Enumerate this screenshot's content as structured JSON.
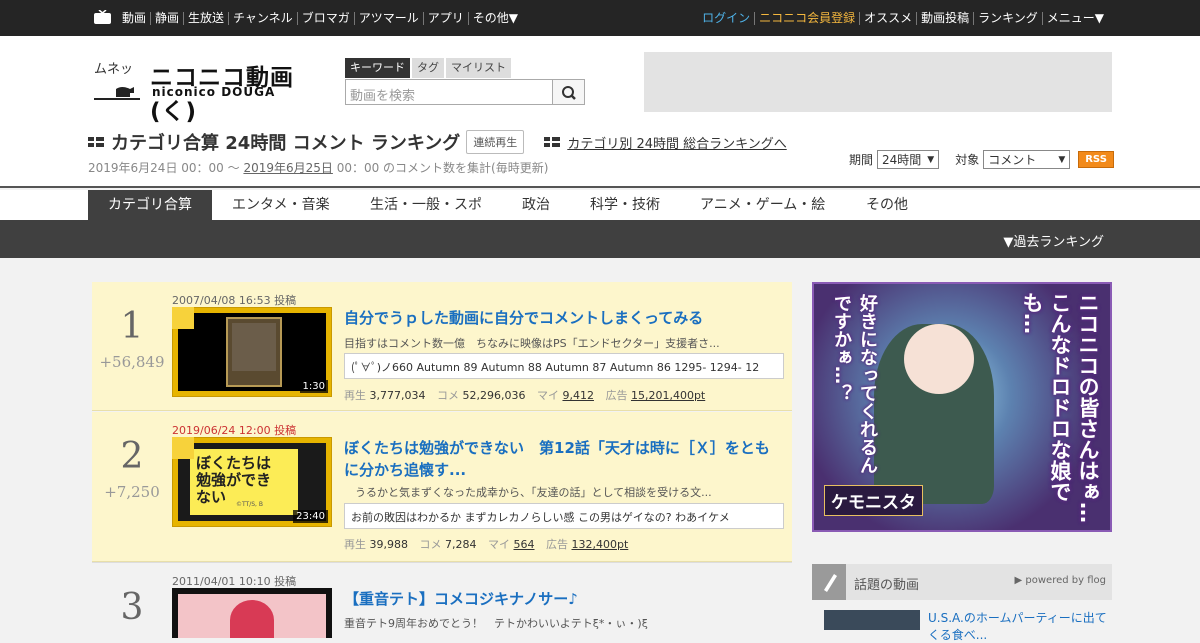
{
  "topbar": {
    "nav": [
      "動画",
      "静画",
      "生放送",
      "チャンネル",
      "ブロマガ",
      "アツマール",
      "アプリ",
      "その他▼"
    ],
    "right": [
      "ログイン",
      "ニコニコ会員登録",
      "オススメ",
      "動画投稿",
      "ランキング",
      "メニュー▼"
    ]
  },
  "header": {
    "logo_top": "ムネッ",
    "logo_main": "ニコニコ動画(く)",
    "logo_sub": "niconico DOUGA",
    "search_tabs": [
      "キーワード",
      "タグ",
      "マイリスト"
    ],
    "search_placeholder": "動画を検索",
    "page_title": "カテゴリ合算 24時間 コメント ランキング",
    "continuous_label": "連続再生",
    "to_overall": "カテゴリ別 24時間 総合ランキングへ",
    "date_from": "2019年6月24日 00：00 ～ ",
    "date_to": "2019年6月25日",
    "date_suffix": " 00：00 のコメント数を集計(毎時更新)",
    "period_label": "期間",
    "period_value": "24時間",
    "target_label": "対象",
    "target_value": "コメント",
    "rss": "RSS"
  },
  "category_tabs": [
    "カテゴリ合算",
    "エンタメ・音楽",
    "生活・一般・スポ",
    "政治",
    "科学・技術",
    "アニメ・ゲーム・絵",
    "その他"
  ],
  "past_ranking": "▼過去ランキング",
  "items": [
    {
      "rank": "1",
      "delta": "+56,849",
      "posted": "2007/04/08 16:53 投稿",
      "length": "1:30",
      "title": "自分でうｐした動画に自分でコメントしまくってみる",
      "desc": "目指すはコメント数一億　ちなみに映像はPS「エンドセクター」支援者さ...",
      "comment": "(ﾟ∀ﾟ)ノ660 Autumn 89 Autumn 88 Autumn 87 Autumn 86 1295- 1294- 12",
      "views_label": "再生",
      "views": "3,777,034",
      "comments_label": "コメ",
      "comments": "52,296,036",
      "mylist_label": "マイ",
      "mylist": "9,412",
      "ads_label": "広告",
      "ads": "15,201,400pt"
    },
    {
      "rank": "2",
      "delta": "+7,250",
      "posted": "2019/06/24 12:00 投稿",
      "length": "23:40",
      "title": "ぼくたちは勉強ができない　第12話「天才は時に［Ｘ］をともに分かち追懐す...",
      "desc": "　うるかと気まずくなった成幸から、「友達の話」として相談を受ける文...",
      "comment": "お前の敗因はわかるか まずカレカノらしい感 この男はゲイなの? わあイケメ",
      "views_label": "再生",
      "views": "39,988",
      "comments_label": "コメ",
      "comments": "7,284",
      "mylist_label": "マイ",
      "mylist": "564",
      "ads_label": "広告",
      "ads": "132,400pt",
      "thumb_text": "ぼくたちは勉強ができない",
      "thumb_credit": "©TT/S, B"
    },
    {
      "rank": "3",
      "delta": "",
      "posted": "2011/04/01 10:10 投稿",
      "title": "【重音テト】コメコジキナノサー♪",
      "desc": "重音テト9周年おめでとう！　テトかわいいよテトξ*・ぃ・)ξ"
    }
  ],
  "sidebar": {
    "ad_text": "ニコニコの皆さんはぁ…こんなドロドロな娘でも…",
    "ad_text2": "好きになってくれるんですかぁ…？",
    "ad_logo": "ケモニスタ",
    "flog_title": "話題の動画",
    "flog_powered": "▶ powered by flog",
    "flog_item": "U.S.A.のホームパーティーに出てくる食べ..."
  },
  "colors": {
    "accent_blue": "#1a6fc0",
    "top_bg": "#252525",
    "highlight_bg": "#fdf6cc",
    "thumb_gold": "#e6b400"
  }
}
